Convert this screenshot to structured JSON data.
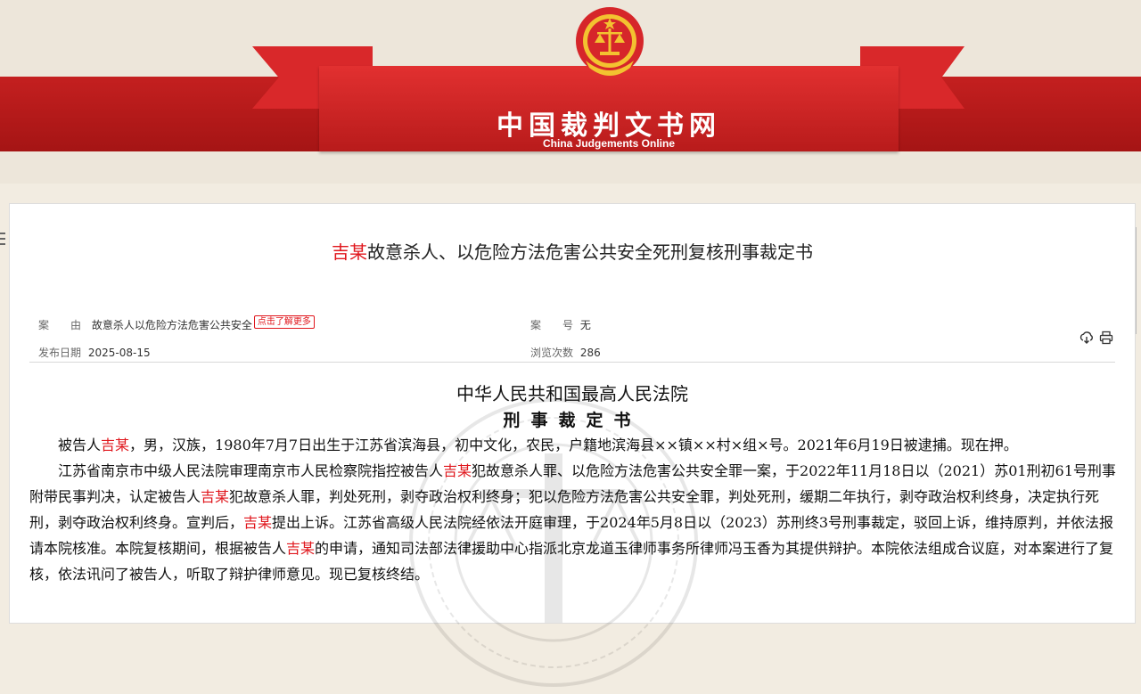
{
  "site": {
    "title_cn": "中国裁判文书网",
    "title_en": "China Judgements Online"
  },
  "document": {
    "title_name": "吉某",
    "title_rest": "故意杀人、以危险方法危害公共安全死刑复核刑事裁定书",
    "cause_label": "案　　由",
    "cause_value": "故意杀人以危险方法危害公共安全",
    "more_tag": "点击了解更多",
    "case_no_label": "案　　号",
    "case_no_value": "无",
    "publish_label": "发布日期",
    "publish_value": "2025-08-15",
    "views_label": "浏览次数",
    "views_value": "286",
    "court": "中华人民共和国最高人民法院",
    "doc_type": "刑事裁定书"
  },
  "paragraphs": [
    {
      "segments": [
        {
          "t": "被告人",
          "red": false
        },
        {
          "t": "吉某",
          "red": true
        },
        {
          "t": "，男，汉族，1980年7月7日出生于江苏省滨海县，初中文化，农民，户籍地滨海县××镇××村×组×号。2021年6月19日被逮捕。现在押。",
          "red": false
        }
      ]
    },
    {
      "segments": [
        {
          "t": "江苏省南京市中级人民法院审理南京市人民检察院指控被告人",
          "red": false
        },
        {
          "t": "吉某",
          "red": true
        },
        {
          "t": "犯故意杀人罪、以危险方法危害公共安全罪一案，于2022年11月18日以（2021）苏01刑初61号刑事附带民事判决，认定被告人",
          "red": false
        },
        {
          "t": "吉某",
          "red": true
        },
        {
          "t": "犯故意杀人罪，判处死刑，剥夺政治权利终身；犯以危险方法危害公共安全罪，判处死刑，缓期二年执行，剥夺政治权利终身，决定执行死刑，剥夺政治权利终身。宣判后，",
          "red": false
        },
        {
          "t": "吉某",
          "red": true
        },
        {
          "t": "提出上诉。江苏省高级人民法院经依法开庭审理，于2024年5月8日以（2023）苏刑终3号刑事裁定，驳回上诉，维持原判，并依法报请本院核准。本院复核期间，根据被告人",
          "red": false
        },
        {
          "t": "吉某",
          "red": true
        },
        {
          "t": "的申请，通知司法部法律援助中心指派北京龙道玉律师事务所律师冯玉香为其提供辩护。本院依法组成合议庭，对本案进行了复核，依法讯问了被告人，听取了辩护律师意见。现已复核终结。",
          "red": false
        }
      ]
    }
  ]
}
